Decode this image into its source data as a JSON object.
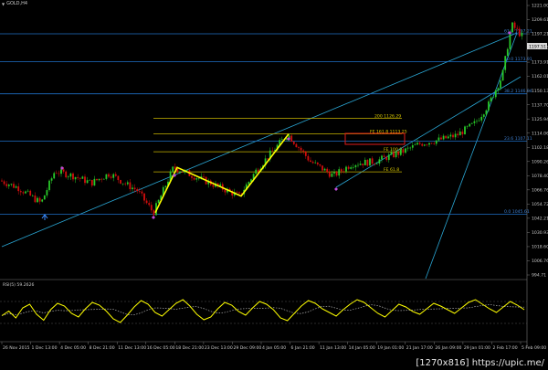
{
  "window": {
    "symbol_label": "GOLD,H4"
  },
  "indicator": {
    "label": "RSI(5) 59.2626"
  },
  "watermark": "[1270x816] https://upic.me/",
  "colors": {
    "bg": "#000000",
    "grid": "#1c1c1c",
    "axis": "#7a7a7a",
    "bull": "#29c929",
    "bear": "#d40d0d",
    "fib": "#1f6fc6",
    "fibo_ext": "#c8b400",
    "zigzag": "#ffff00",
    "channel": "#2aa6d4",
    "rsi": "#ffff00",
    "rsi_ma": "#cfcfcf",
    "box": "#e01b1b",
    "price_box": "#d8d8d8"
  },
  "price_axis": {
    "ticks": [
      "1221.00",
      "1209.61",
      "1197.21",
      "1185.75",
      "1173.91",
      "1162.01",
      "1150.13",
      "1137.70",
      "1125.94",
      "1114.06",
      "1102.18",
      "1090.26",
      "1078.40",
      "1066.76",
      "1054.72",
      "1042.21",
      "1030.93",
      "1018.60",
      "1006.76",
      "994.71"
    ],
    "current_price": "1197.51"
  },
  "time_axis": {
    "ticks": [
      "26 Nov 2015",
      "1 Dec 13:00",
      "4 Dec 05:00",
      "8 Dec 21:00",
      "11 Dec 13:00",
      "16 Dec 05:00",
      "18 Dec 21:00",
      "23 Dec 13:00",
      "29 Dec 09:00",
      "4 Jan 05:00",
      "6 Jan 21:00",
      "11 Jan 13:00",
      "14 Jan 05:00",
      "19 Jan 01:00",
      "21 Jan 17:00",
      "26 Jan 09:00",
      "29 Jan 01:00",
      "2 Feb 17:00",
      "5 Feb 09:00"
    ]
  },
  "fib_levels": [
    {
      "label": "61.8  1197.21",
      "price": 1197.21
    },
    {
      "label": "50.0  1173.91",
      "price": 1173.91
    },
    {
      "label": "38.2  1146.84",
      "price": 1146.84
    },
    {
      "label": "23.6  1107.11",
      "price": 1107.11
    },
    {
      "label": "0.0  1045.61",
      "price": 1045.61
    }
  ],
  "fibo_expansion": [
    {
      "label": "200  1126.29",
      "price": 1126.29
    },
    {
      "label": "FE 161.8  1113.25",
      "price": 1113.25
    },
    {
      "label": "FE 100.0",
      "price": 1098.18
    },
    {
      "label": "FE 61.8",
      "price": 1081.29
    }
  ],
  "zigzag_prices": [
    1047,
    1085,
    1061,
    1113
  ],
  "rsi_series": [
    45,
    55,
    40,
    62,
    70,
    48,
    35,
    58,
    72,
    66,
    50,
    42,
    60,
    74,
    68,
    55,
    38,
    30,
    46,
    64,
    78,
    70,
    52,
    44,
    58,
    72,
    80,
    66,
    48,
    36,
    42,
    60,
    74,
    68,
    54,
    46,
    62,
    76,
    70,
    58,
    40,
    34,
    50,
    66,
    78,
    72,
    60,
    52,
    44,
    58,
    70,
    80,
    74,
    62,
    50,
    42,
    56,
    70,
    64,
    54,
    48,
    60,
    72,
    66,
    58,
    50,
    62,
    74,
    80,
    70,
    60,
    52,
    64,
    76,
    68,
    58
  ]
}
